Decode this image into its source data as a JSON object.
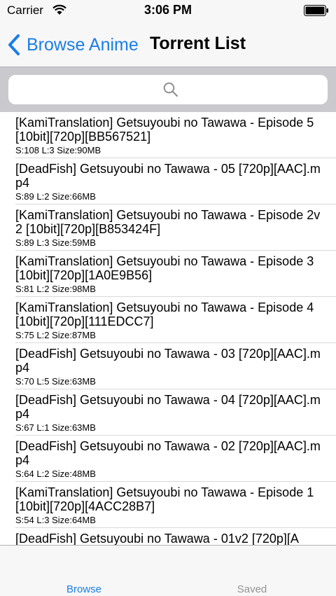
{
  "status_bar": {
    "carrier": "Carrier",
    "time": "3:06 PM"
  },
  "nav": {
    "back_label": "Browse Anime",
    "title": "Torrent List"
  },
  "search": {
    "placeholder": "",
    "value": ""
  },
  "torrents": [
    {
      "title": "[KamiTranslation] Getsuyoubi no Tawawa - Episode 5 [10bit][720p][BB567521]",
      "meta": "S:108 L:3 Size:90MB"
    },
    {
      "title": "[DeadFish] Getsuyoubi no Tawawa - 05 [720p][AAC].mp4",
      "meta": "S:89 L:2 Size:66MB"
    },
    {
      "title": "[KamiTranslation] Getsuyoubi no Tawawa - Episode 2v2 [10bit][720p][B853424F]",
      "meta": "S:89 L:3 Size:59MB"
    },
    {
      "title": "[KamiTranslation] Getsuyoubi no Tawawa - Episode 3 [10bit][720p][1A0E9B56]",
      "meta": "S:81 L:2 Size:98MB"
    },
    {
      "title": "[KamiTranslation] Getsuyoubi no Tawawa - Episode 4 [10bit][720p][111EDCC7]",
      "meta": "S:75 L:2 Size:87MB"
    },
    {
      "title": "[DeadFish] Getsuyoubi no Tawawa - 03 [720p][AAC].mp4",
      "meta": "S:70 L:5 Size:63MB"
    },
    {
      "title": "[DeadFish] Getsuyoubi no Tawawa - 04 [720p][AAC].mp4",
      "meta": "S:67 L:1 Size:63MB"
    },
    {
      "title": "[DeadFish] Getsuyoubi no Tawawa - 02 [720p][AAC].mp4",
      "meta": "S:64 L:2 Size:48MB"
    },
    {
      "title": "[KamiTranslation] Getsuyoubi no Tawawa - Episode 1 [10bit][720p][4ACC28B7]",
      "meta": "S:54 L:3 Size:64MB"
    },
    {
      "title": "[DeadFish] Getsuyoubi no Tawawa - 01v2 [720p][A",
      "meta": ""
    }
  ],
  "tab_bar": {
    "browse_label": "Browse",
    "saved_label": "Saved",
    "active_tab": "Browse"
  },
  "colors": {
    "accent": "#1a7ee8",
    "inactive_tab": "#929292",
    "search_background": "#c9c9ce"
  },
  "icons": {
    "wifi": "wifi-icon",
    "battery": "battery-icon",
    "back": "chevron-left-icon",
    "search": "search-icon"
  }
}
